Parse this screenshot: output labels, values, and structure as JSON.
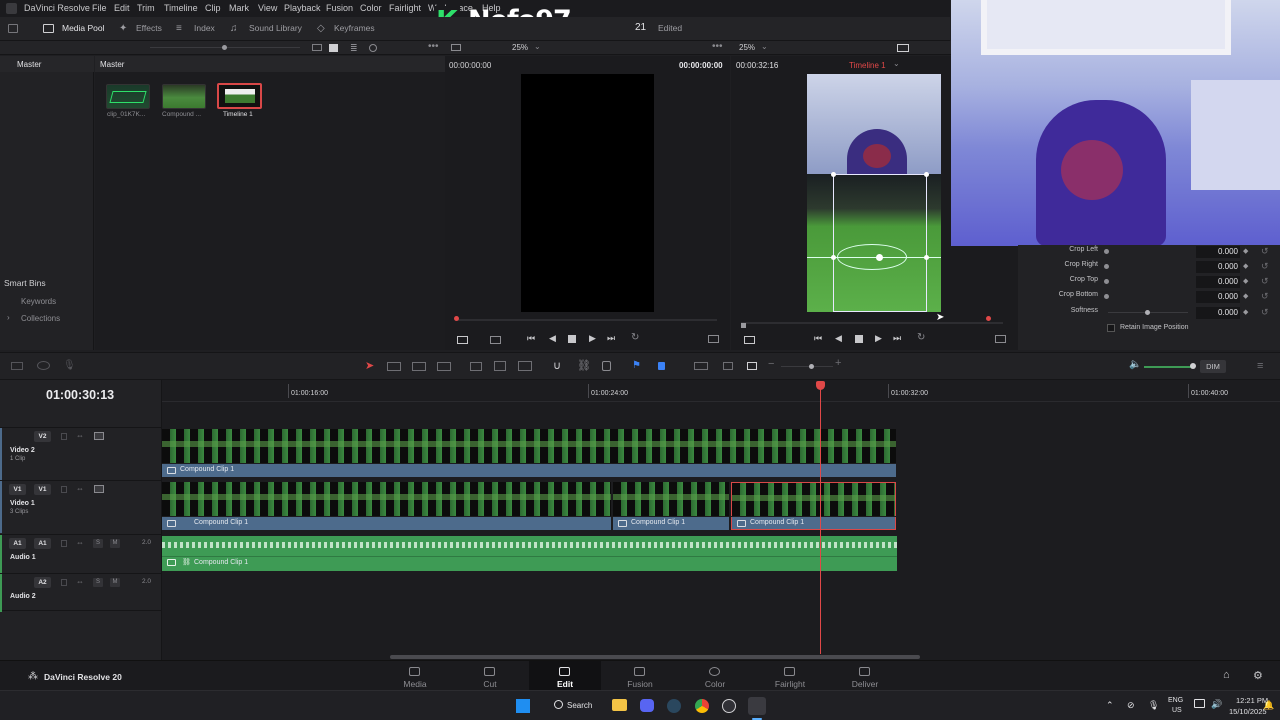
{
  "app": {
    "title": "DaVinci Resolve",
    "project_count": "21",
    "edited_status": "Edited",
    "footer_brand": "DaVinci Resolve 20"
  },
  "menu": [
    "File",
    "Edit",
    "Trim",
    "Timeline",
    "Clip",
    "Mark",
    "View",
    "Playback",
    "Fusion",
    "Color",
    "Fairlight",
    "Workspace",
    "Help"
  ],
  "toolbar": {
    "media_pool": "Media Pool",
    "effects": "Effects",
    "index": "Index",
    "sound_library": "Sound Library",
    "keyframes": "Keyframes"
  },
  "overlay": {
    "channel_name": "Nefo97",
    "logo_letter": "K"
  },
  "bins": {
    "master": "Master",
    "smart_bins": "Smart Bins",
    "keywords": "Keywords",
    "collections": "Collections"
  },
  "media_pool": {
    "header": "Master",
    "clips": [
      {
        "label": "clip_01K7K...",
        "selected": false
      },
      {
        "label": "Compound ...",
        "selected": false
      },
      {
        "label": "Timeline 1",
        "selected": true
      }
    ]
  },
  "source_viewer": {
    "zoom": "25%",
    "timecode_left": "00:00:00:00",
    "timecode_right": "00:00:00:00"
  },
  "timeline_viewer": {
    "zoom": "25%",
    "timecode": "00:00:32:16",
    "timeline_name": "Timeline 1"
  },
  "inspector": {
    "rows": [
      {
        "label": "Crop Left",
        "value": "0.000"
      },
      {
        "label": "Crop Right",
        "value": "0.000"
      },
      {
        "label": "Crop Top",
        "value": "0.000"
      },
      {
        "label": "Crop Bottom",
        "value": "0.000"
      },
      {
        "label": "Softness",
        "value": "0.000"
      }
    ],
    "retain_label": "Retain Image Position"
  },
  "timeline": {
    "current_timecode": "01:00:30:13",
    "ruler_marks": [
      "01:00:16:00",
      "01:00:24:00",
      "01:00:32:00",
      "01:00:40:00"
    ],
    "dim_label": "DIM",
    "tracks": {
      "v2": {
        "tag": "V2",
        "name": "Video 2",
        "sub": "1 Clip"
      },
      "v1": {
        "tag_a": "V1",
        "tag_b": "V1",
        "name": "Video 1",
        "sub": "3 Clips"
      },
      "a1": {
        "tag_a": "A1",
        "tag_b": "A1",
        "name": "Audio 1",
        "level": "2.0"
      },
      "a2": {
        "tag": "A2",
        "name": "Audio 2",
        "level": "2.0"
      },
      "solo": "S",
      "mute": "M"
    },
    "clip_label": "Compound Clip 1"
  },
  "pages": [
    "Media",
    "Cut",
    "Edit",
    "Fusion",
    "Color",
    "Fairlight",
    "Deliver"
  ],
  "active_page": "Edit",
  "taskbar": {
    "search": "Search",
    "lang_top": "ENG",
    "lang_bottom": "US",
    "time": "12:21 PM",
    "date": "15/10/2025"
  },
  "colors": {
    "accent_red": "#e04848",
    "clip_blue": "#4d6b8c",
    "audio_green": "#3e9b55"
  }
}
